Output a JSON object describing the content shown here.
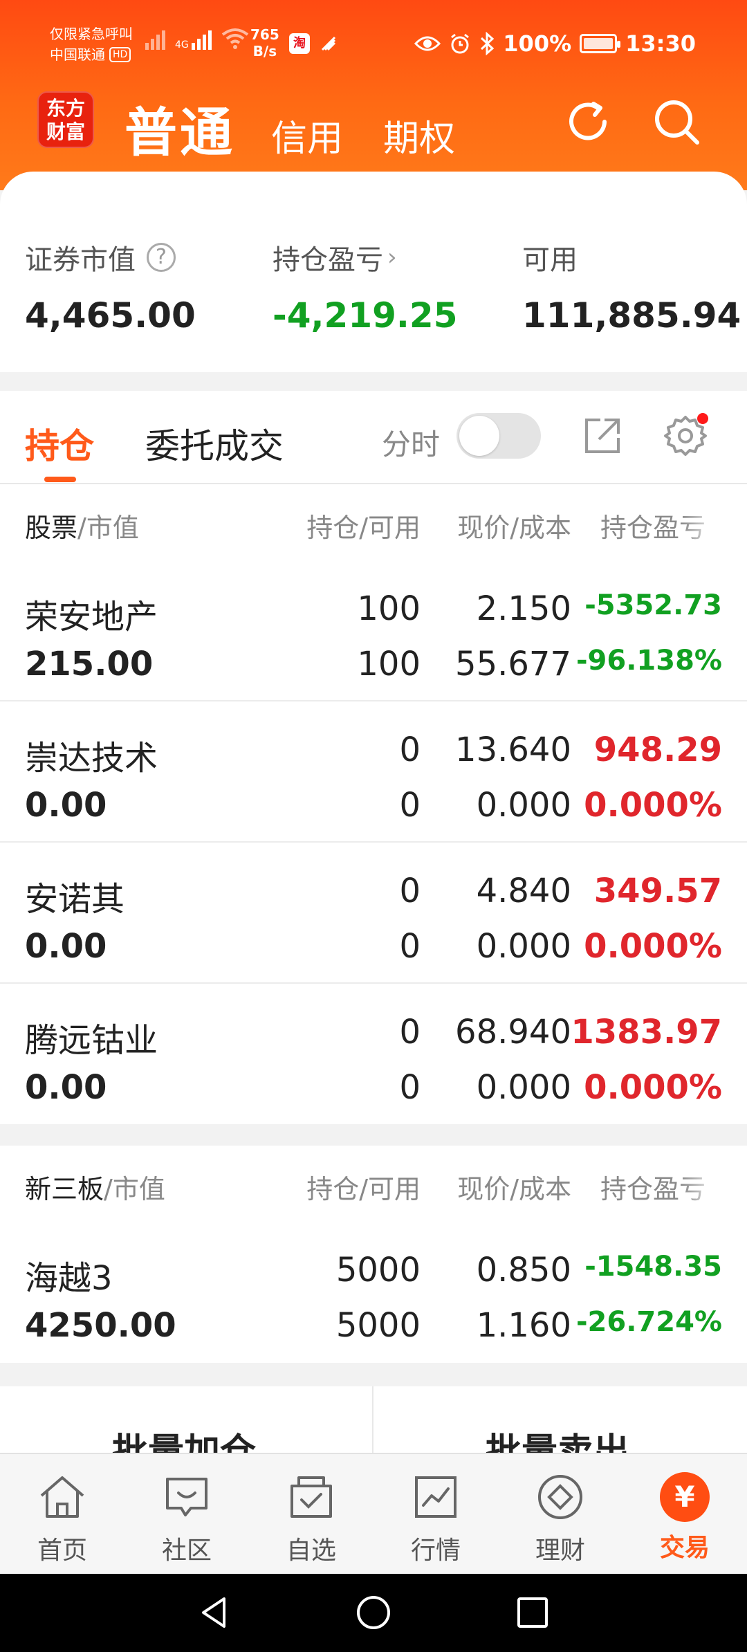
{
  "status_bar": {
    "emergency": "仅限紧急呼叫",
    "carrier": "中国联通",
    "hd": "HD",
    "net_type": "4G",
    "speed_value": "765",
    "speed_unit": "B/s",
    "battery": "100%",
    "time": "13:30"
  },
  "header": {
    "logo_line1": "东方",
    "logo_line2": "财富",
    "tabs": [
      "普通",
      "信用",
      "期权"
    ]
  },
  "summary": {
    "market_value_label": "证券市值",
    "market_value": "4,465.00",
    "pnl_label": "持仓盈亏",
    "pnl": "-4,219.25",
    "available_label": "可用",
    "available": "111,885.94"
  },
  "holdings_tabs": {
    "positions": "持仓",
    "orders": "委托成交",
    "fenshi": "分时"
  },
  "stock_table": {
    "header": {
      "stock": "股票",
      "mv": "/市值",
      "qty": "持仓/可用",
      "price": "现价/成本",
      "pnl": "持仓盈亏"
    },
    "rows": [
      {
        "name": "荣安地产",
        "market_value": "215.00",
        "position": "100",
        "available": "100",
        "price": "2.150",
        "cost": "55.677",
        "pnl": "-5352.73",
        "pnl_pct": "-96.138%",
        "trend": "down"
      },
      {
        "name": "崇达技术",
        "market_value": "0.00",
        "position": "0",
        "available": "0",
        "price": "13.640",
        "cost": "0.000",
        "pnl": "948.29",
        "pnl_pct": "0.000%",
        "trend": "up"
      },
      {
        "name": "安诺其",
        "market_value": "0.00",
        "position": "0",
        "available": "0",
        "price": "4.840",
        "cost": "0.000",
        "pnl": "349.57",
        "pnl_pct": "0.000%",
        "trend": "up"
      },
      {
        "name": "腾远钴业",
        "market_value": "0.00",
        "position": "0",
        "available": "0",
        "price": "68.940",
        "cost": "0.000",
        "pnl": "1383.97",
        "pnl_pct": "0.000%",
        "trend": "up"
      }
    ]
  },
  "neeq_table": {
    "header": {
      "stock": "新三板",
      "mv": "/市值",
      "qty": "持仓/可用",
      "price": "现价/成本",
      "pnl": "持仓盈亏"
    },
    "rows": [
      {
        "name": "海越3",
        "market_value": "4250.00",
        "position": "5000",
        "available": "5000",
        "price": "0.850",
        "cost": "1.160",
        "pnl": "-1548.35",
        "pnl_pct": "-26.724%",
        "trend": "down"
      }
    ]
  },
  "batch": {
    "add": "批量加仓",
    "sell": "批量卖出"
  },
  "bottom_nav": [
    {
      "label": "首页",
      "icon": "home-icon"
    },
    {
      "label": "社区",
      "icon": "community-icon"
    },
    {
      "label": "自选",
      "icon": "watchlist-icon"
    },
    {
      "label": "行情",
      "icon": "market-icon"
    },
    {
      "label": "理财",
      "icon": "wealth-icon"
    },
    {
      "label": "交易",
      "icon": "trade-icon"
    }
  ],
  "colors": {
    "brand_orange": "#ff5a1a",
    "up_red": "#e0262c",
    "down_green": "#11a021"
  }
}
